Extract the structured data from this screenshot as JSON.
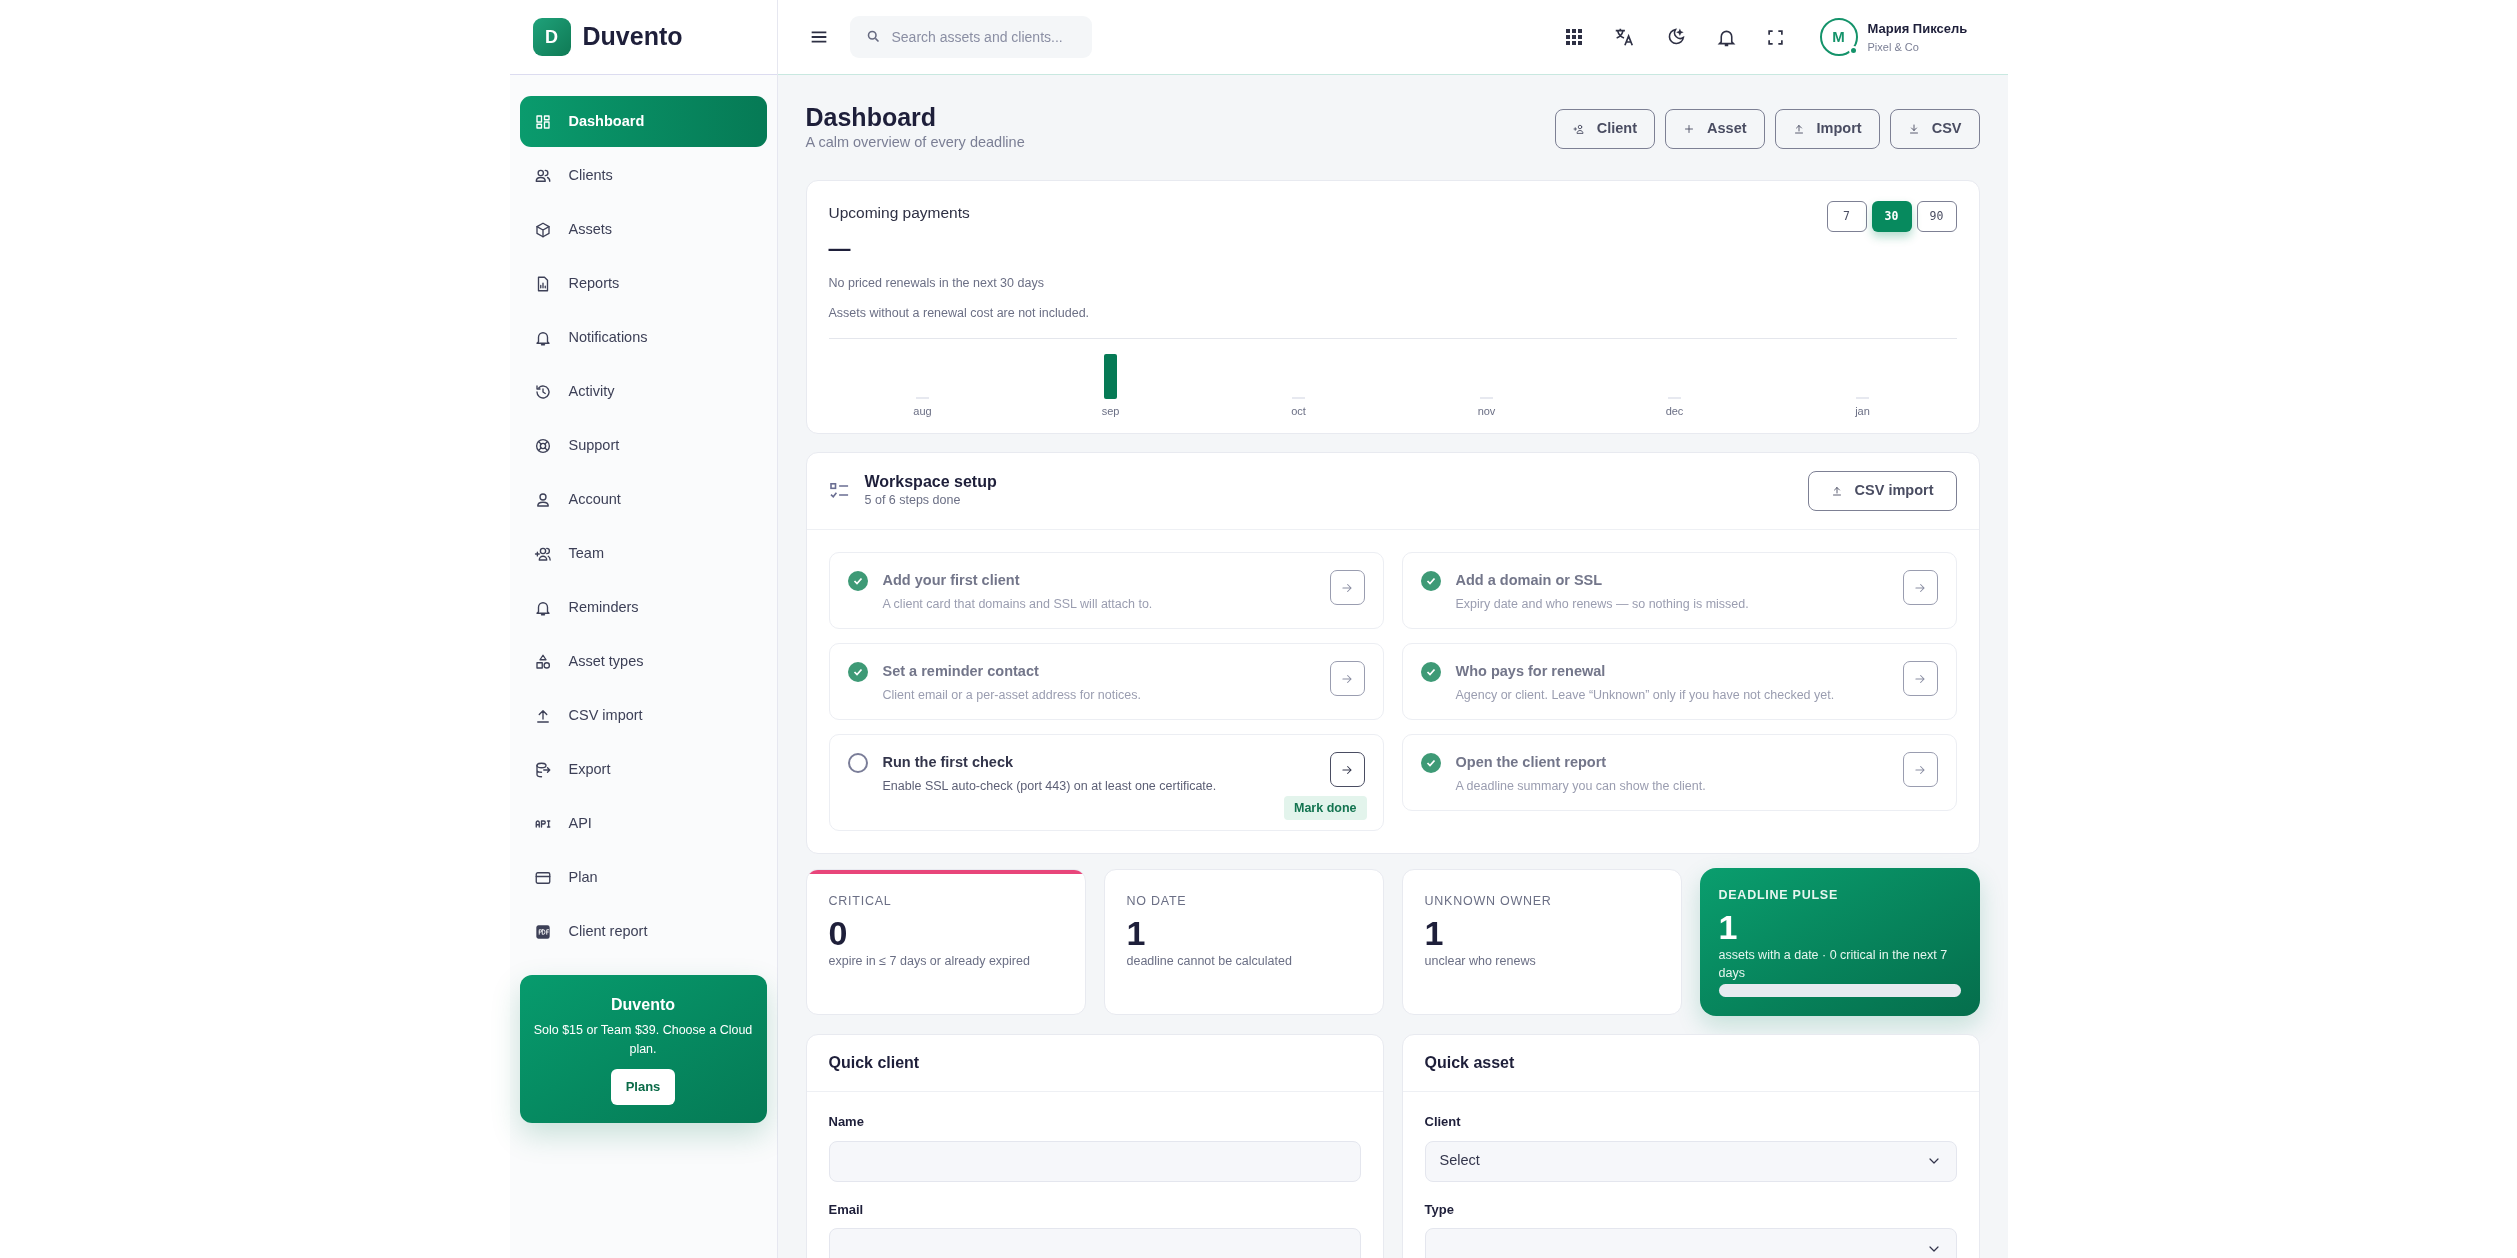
{
  "brand": {
    "logo_letter": "D",
    "name": "Duvento"
  },
  "nav": [
    {
      "label": "Dashboard",
      "selected": true
    },
    {
      "label": "Clients",
      "selected": false
    },
    {
      "label": "Assets",
      "selected": false
    },
    {
      "label": "Reports",
      "selected": false
    },
    {
      "label": "Notifications",
      "selected": false
    },
    {
      "label": "Activity",
      "selected": false
    },
    {
      "label": "Support",
      "selected": false
    },
    {
      "label": "Account",
      "selected": false
    },
    {
      "label": "Team",
      "selected": false
    },
    {
      "label": "Reminders",
      "selected": false
    },
    {
      "label": "Asset types",
      "selected": false
    },
    {
      "label": "CSV import",
      "selected": false
    },
    {
      "label": "Export",
      "selected": false
    },
    {
      "label": "API",
      "selected": false
    },
    {
      "label": "Plan",
      "selected": false
    },
    {
      "label": "Client report",
      "selected": false
    }
  ],
  "promo": {
    "title": "Duvento",
    "text": "Solo $15 or Team $39. Choose a Cloud plan.",
    "button": "Plans"
  },
  "topbar": {
    "search_placeholder": "Search assets and clients...",
    "user": {
      "initial": "M",
      "name": "Мария Пиксель",
      "org": "Pixel & Co",
      "online": true
    }
  },
  "page": {
    "title": "Dashboard",
    "subtitle": "A calm overview of every deadline",
    "actions": [
      "Client",
      "Asset",
      "Import",
      "CSV"
    ]
  },
  "payments": {
    "title": "Upcoming payments",
    "ranges": [
      {
        "label": "7",
        "selected": false
      },
      {
        "label": "30",
        "selected": true
      },
      {
        "label": "90",
        "selected": false
      }
    ],
    "total": "—",
    "note": "No priced renewals in the next 30 days",
    "hint": "Assets without a renewal cost are not included.",
    "months": [
      {
        "label": "aug",
        "kind": "empty"
      },
      {
        "label": "sep",
        "kind": "bar"
      },
      {
        "label": "oct",
        "kind": "empty"
      },
      {
        "label": "nov",
        "kind": "empty"
      },
      {
        "label": "dec",
        "kind": "empty"
      },
      {
        "label": "jan",
        "kind": "empty"
      }
    ]
  },
  "setup": {
    "title": "Workspace setup",
    "progress": "5 of 6 steps done",
    "button": "CSV import",
    "steps": [
      {
        "title": "Add your first client",
        "text": "A client card that domains and SSL will attach to.",
        "done": true
      },
      {
        "title": "Add a domain or SSL",
        "text": "Expiry date and who renews — so nothing is missed.",
        "done": true
      },
      {
        "title": "Set a reminder contact",
        "text": "Client email or a per-asset address for notices.",
        "done": true
      },
      {
        "title": "Who pays for renewal",
        "text": "Agency or client. Leave “Unknown” only if you have not checked yet.",
        "done": true
      },
      {
        "title": "Run the first check",
        "text": "Enable SSL auto-check (port 443) on at least one certificate.",
        "done": false,
        "action": "Mark done"
      },
      {
        "title": "Open the client report",
        "text": "A deadline summary you can show the client.",
        "done": true
      }
    ]
  },
  "stats": [
    {
      "kind": "plain",
      "label": "CRITICAL",
      "value": "0",
      "text": "expire in ≤ 7 days or already expired",
      "color": "#e8457a"
    },
    {
      "kind": "plain",
      "label": "NO DATE",
      "value": "1",
      "text": "deadline cannot be calculated"
    },
    {
      "kind": "plain",
      "label": "UNKNOWN OWNER",
      "value": "1",
      "text": "unclear who renews"
    },
    {
      "kind": "pulse",
      "label": "DEADLINE PULSE",
      "value": "1",
      "text": "assets with a date · 0 critical in the next 7 days",
      "level": 1
    }
  ],
  "quick_client": {
    "title": "Quick client",
    "fields": [
      {
        "label": "Name",
        "kind": "input"
      },
      {
        "label": "Email",
        "kind": "input"
      }
    ]
  },
  "quick_asset": {
    "title": "Quick asset",
    "fields": [
      {
        "label": "Client",
        "kind": "select",
        "value": "Select"
      },
      {
        "label": "Type",
        "kind": "select"
      }
    ]
  }
}
